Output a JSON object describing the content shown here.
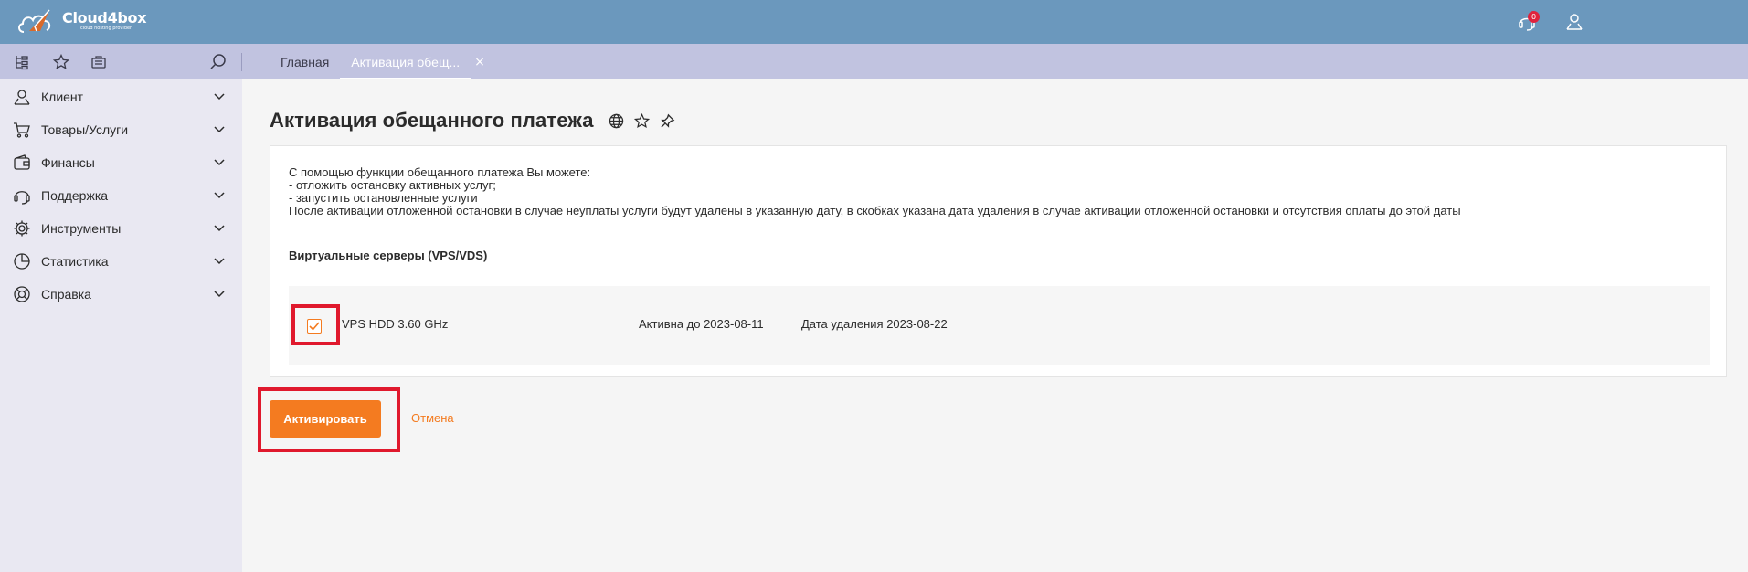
{
  "header": {
    "logo_title": "Cloud4box",
    "logo_subtitle": "cloud hosting provider",
    "notifications_count": "0",
    "icons": [
      "support-chat-icon",
      "user-profile-icon"
    ]
  },
  "toolbar": {
    "icons": [
      "tree-view-icon",
      "star-icon",
      "briefcase-icon",
      "search-icon"
    ]
  },
  "tabs": [
    {
      "label": "Главная"
    },
    {
      "label": "Активация обещ..."
    }
  ],
  "tab_close": "×",
  "sidebar": {
    "items": [
      {
        "label": "Клиент",
        "icon": "client-icon"
      },
      {
        "label": "Товары/Услуги",
        "icon": "cart-icon"
      },
      {
        "label": "Финансы",
        "icon": "wallet-icon"
      },
      {
        "label": "Поддержка",
        "icon": "headset-icon"
      },
      {
        "label": "Инструменты",
        "icon": "gear-icon"
      },
      {
        "label": "Статистика",
        "icon": "pie-chart-icon"
      },
      {
        "label": "Справка",
        "icon": "lifebuoy-icon"
      }
    ]
  },
  "page": {
    "title": "Активация обещанного платежа",
    "description": [
      "С помощью функции обещанного платежа Вы можете:",
      "- отложить остановку активных услуг;",
      "- запустить остановленные услуги",
      "После активации отложенной остановки в случае неуплаты услуги будут удалены в указанную дату, в скобках указана дата удаления в случае активации отложенной остановки и отсутствия оплаты до этой даты"
    ],
    "section_title": "Виртуальные серверы (VPS/VDS)",
    "service": {
      "name": "VPS HDD 3.60 GHz",
      "active_until": "Активна до 2023-08-11",
      "delete_date": "Дата удаления 2023-08-22",
      "checked": true
    },
    "activate_label": "Активировать",
    "cancel_label": "Отмена"
  },
  "colors": {
    "header_bg": "#6b98bd",
    "subbar_bg": "#c1c3e0",
    "sidebar_bg": "#e9e8f2",
    "accent": "#f47b20",
    "highlight": "#e0192d"
  }
}
